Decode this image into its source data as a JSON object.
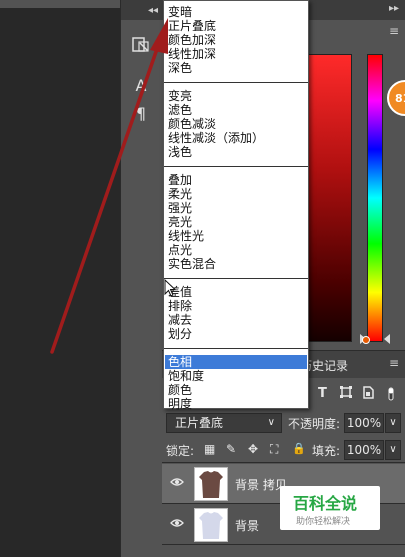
{
  "toolcolumn": {
    "collapse_glyph": "◂◂",
    "tool_a": "A",
    "tool_p": "¶"
  },
  "panel": {
    "expand_glyph": "▸▸",
    "menu_glyph": "≡",
    "badge_text": "81"
  },
  "tabs": {
    "history": "历史记录",
    "history_visible": "历史记录",
    "menu_glyph": "≡"
  },
  "blend_dropdown": {
    "items": [
      "变暗",
      "正片叠底",
      "颜色加深",
      "线性加深",
      "深色",
      "变亮",
      "滤色",
      "颜色减淡",
      "线性减淡（添加）",
      "浅色",
      "叠加",
      "柔光",
      "强光",
      "亮光",
      "线性光",
      "点光",
      "实色混合",
      "差值",
      "排除",
      "减去",
      "划分",
      "色相",
      "饱和度",
      "颜色",
      "明度"
    ],
    "selected": "色相",
    "cursor_overlap_text": "差值"
  },
  "layers_panel": {
    "blend_mode": "正片叠底",
    "opacity_label": "不透明度:",
    "opacity_value": "100%",
    "lock_label": "锁定:",
    "fill_label": "填充:",
    "fill_value": "100%",
    "filter_icons": [
      "T",
      "□",
      "▤"
    ],
    "lock_icons": [
      "▦",
      "✎",
      "✥",
      "⛶",
      "🔒"
    ]
  },
  "layers": [
    {
      "name": "背景 拷贝",
      "visible_name": "背景 拷贝"
    },
    {
      "name": "背景"
    }
  ],
  "watermark": {
    "title": "百科全说",
    "subtitle": "助你轻松解决"
  },
  "colors": {
    "panel_bg": "#535353",
    "canvas_bg": "#282828",
    "selection": "#3d7bd8",
    "arrow": "#a01c1c",
    "badge": "#f08a24",
    "watermark_green": "#27a744"
  }
}
